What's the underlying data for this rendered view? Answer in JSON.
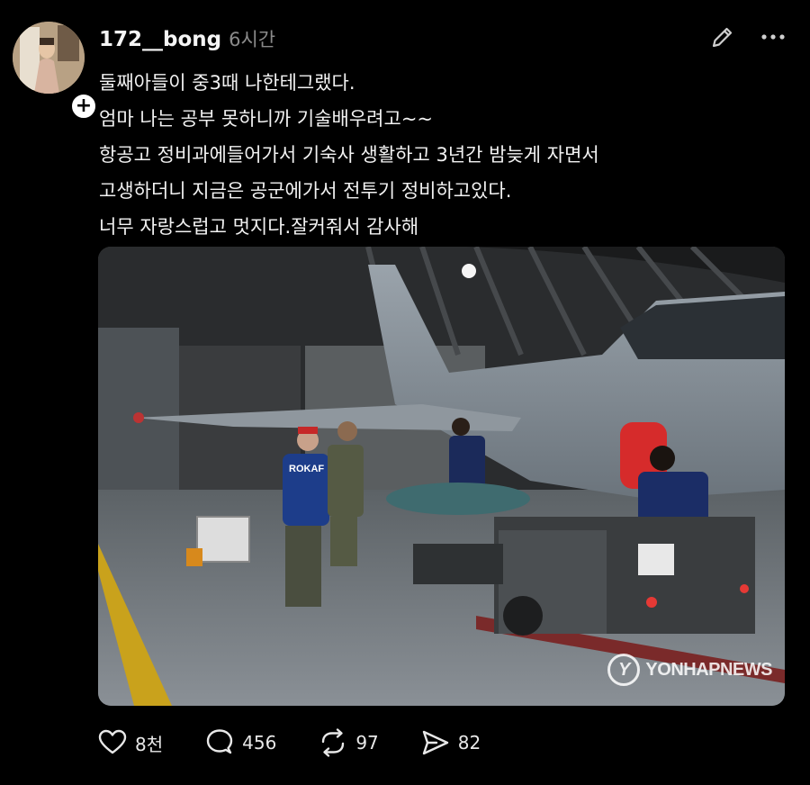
{
  "post": {
    "username": "172__bong",
    "timestamp": "6시간",
    "follow_icon": "plus-icon",
    "lines": [
      "둘째아들이 중3때 나한테그랬다.",
      "엄마 나는 공부 못하니까 기술배우려고~~",
      "항공고 정비과에들어가서 기숙사 생활하고 3년간 밤늦게 자면서",
      "고생하더니 지금은 공군에가서 전투기 정비하고있다.",
      "너무 자랑스럽고 멋지다.잘커줘서 감사해"
    ],
    "image": {
      "watermark": "YONHAPNEWS",
      "watermark_logo": "Y",
      "vest_text": "ROKAF"
    }
  },
  "actions": {
    "like": {
      "icon": "heart-icon",
      "count": "8천"
    },
    "reply": {
      "icon": "comment-icon",
      "count": "456"
    },
    "repost": {
      "icon": "repost-icon",
      "count": "97"
    },
    "share": {
      "icon": "send-icon",
      "count": "82"
    }
  },
  "colors": {
    "background": "#000000",
    "text": "#f2f2f2",
    "muted": "#8a8a8a"
  }
}
